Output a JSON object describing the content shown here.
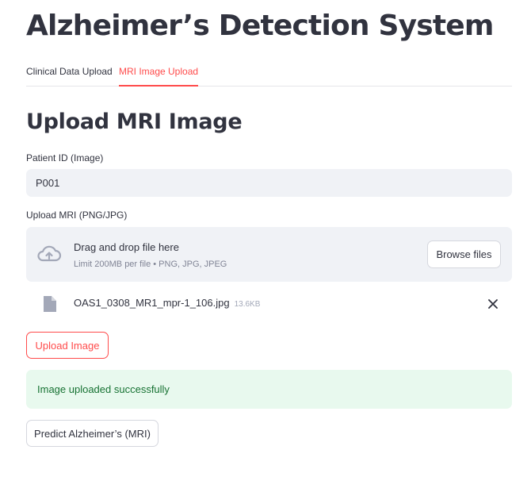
{
  "app": {
    "title": "Alzheimer’s Detection System"
  },
  "tabs": [
    {
      "label": "Clinical Data Upload",
      "active": false
    },
    {
      "label": "MRI Image Upload",
      "active": true
    }
  ],
  "section": {
    "title": "Upload MRI Image"
  },
  "patient_id": {
    "label": "Patient ID (Image)",
    "value": "P001"
  },
  "uploader": {
    "label": "Upload MRI (PNG/JPG)",
    "drop_text": "Drag and drop file here",
    "limit_text": "Limit 200MB per file • PNG, JPG, JPEG",
    "browse_label": "Browse files",
    "icon": "cloud-upload-icon"
  },
  "uploaded_file": {
    "name": "OAS1_0308_MR1_mpr-1_106.jpg",
    "size": "13.6KB",
    "icon": "file-icon",
    "remove_icon": "close-icon"
  },
  "upload_button": {
    "label": "Upload Image"
  },
  "alert": {
    "text": "Image uploaded successfully",
    "type": "success"
  },
  "predict_button": {
    "label": "Predict Alzheimer’s (MRI)"
  },
  "colors": {
    "accent": "#ff4b4b",
    "input_bg": "#f0f2f6",
    "success_bg": "#e8f9ee",
    "success_text": "#177233",
    "text": "#31333f",
    "muted": "#808495"
  }
}
